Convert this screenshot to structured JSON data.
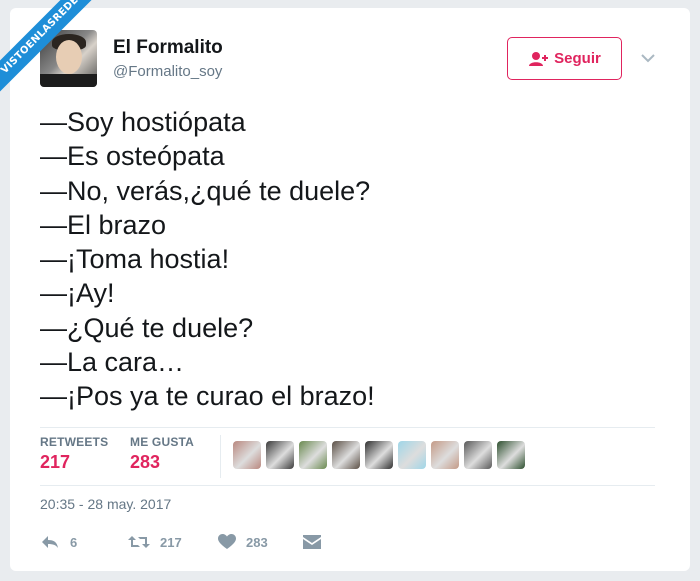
{
  "watermark": "VISTOENLASREDES",
  "user": {
    "name": "El Formalito",
    "handle": "@Formalito_soy"
  },
  "follow_button": {
    "label": "Seguir"
  },
  "tweet_lines": [
    "—Soy hostiópata",
    "—Es osteópata",
    "—No, verás,¿qué te duele?",
    "—El brazo",
    "—¡Toma hostia!",
    "—¡Ay!",
    "—¿Qué te duele?",
    "—La cara…",
    "—¡Pos ya te curao el brazo!"
  ],
  "stats": {
    "retweets_label": "RETWEETS",
    "retweets_value": "217",
    "likes_label": "ME GUSTA",
    "likes_value": "283"
  },
  "liker_colors": [
    "#b9877e",
    "#3a3a3a",
    "#6a8a4f",
    "#5b4f45",
    "#2f2f2f",
    "#9fd6e8",
    "#c49a86",
    "#585858",
    "#2d4f2e"
  ],
  "timestamp": "20:35 - 28 may. 2017",
  "actions": {
    "reply_count": "6",
    "retweet_count": "217",
    "like_count": "283"
  },
  "colors": {
    "accent": "#e0245e",
    "muted": "#657786",
    "action_icon": "#8899a6",
    "ribbon": "#1e8ed8"
  }
}
